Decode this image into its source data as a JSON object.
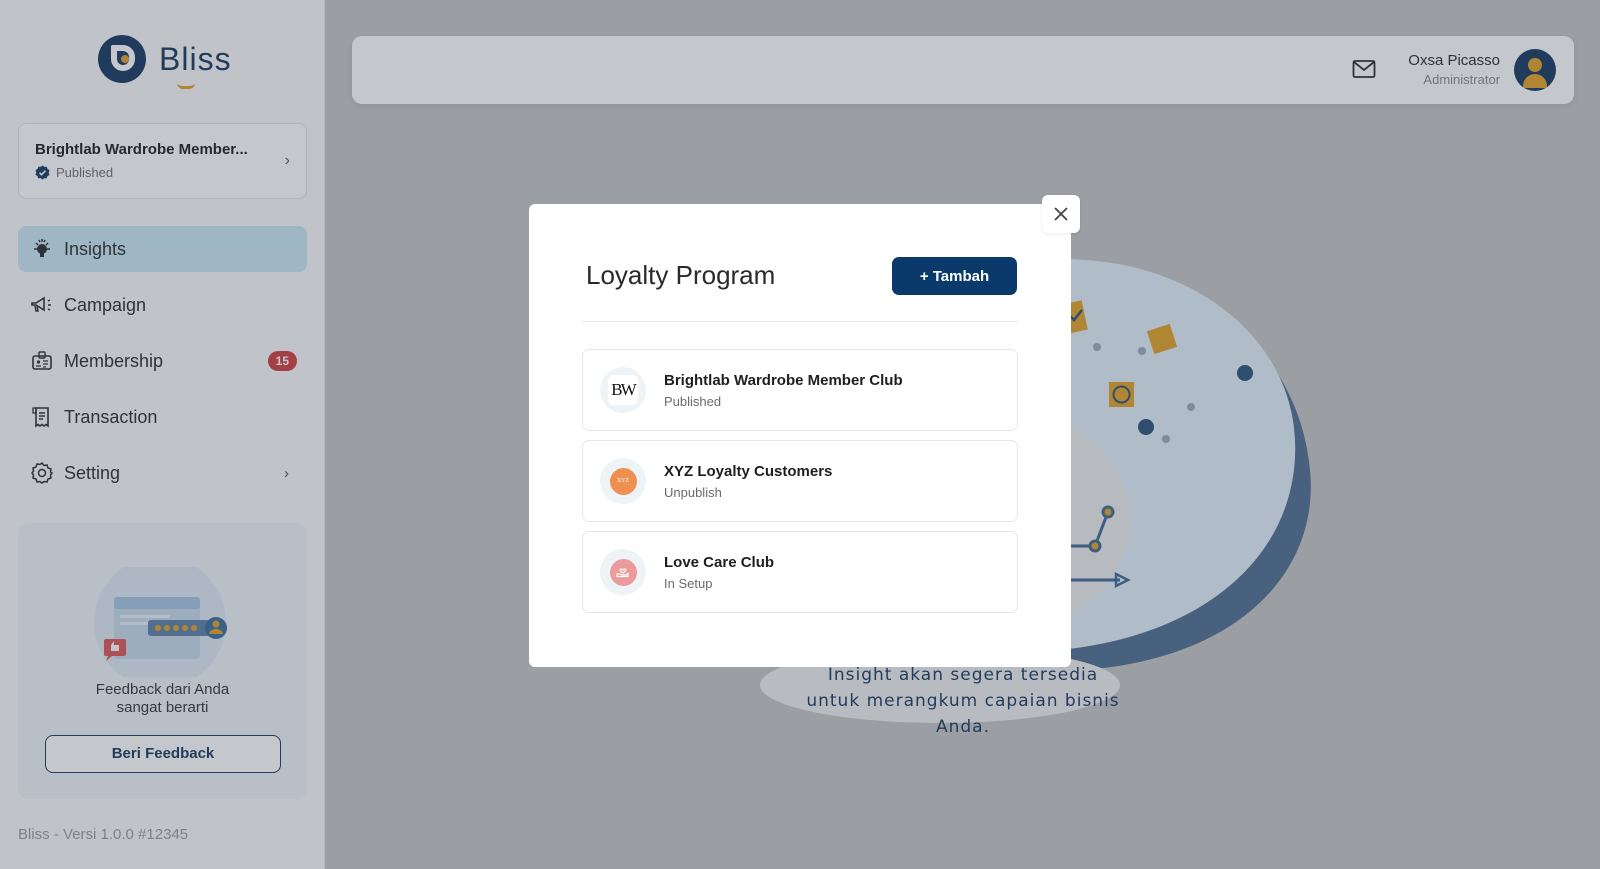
{
  "app": {
    "brand": "Bliss",
    "version_text": "Bliss - Versi 1.0.0 #12345"
  },
  "sidebar": {
    "current_program": {
      "name": "Brightlab Wardrobe Member...",
      "status": "Published",
      "status_icon": "verified-badge-icon"
    },
    "items": [
      {
        "label": "Insights",
        "icon": "lightbulb-icon",
        "active": true
      },
      {
        "label": "Campaign",
        "icon": "megaphone-icon"
      },
      {
        "label": "Membership",
        "icon": "id-card-icon",
        "badge": "15"
      },
      {
        "label": "Transaction",
        "icon": "receipt-icon"
      },
      {
        "label": "Setting",
        "icon": "gear-icon",
        "has_submenu": true
      }
    ],
    "feedback": {
      "message_line1": "Feedback dari Anda",
      "message_line2": "sangat berarti",
      "button_label": "Beri Feedback"
    }
  },
  "header": {
    "mail_icon": "mail-icon",
    "user": {
      "name": "Oxsa Picasso",
      "role": "Administrator"
    }
  },
  "main": {
    "empty_state": {
      "line1": "Insight akan segera tersedia",
      "line2": "untuk merangkum capaian bisnis Anda."
    }
  },
  "modal": {
    "title": "Loyalty Program",
    "add_button_label": "+ Tambah",
    "close_icon": "close-icon",
    "programs": [
      {
        "name": "Brightlab Wardrobe Member Club",
        "status": "Published",
        "logo_text": "BW"
      },
      {
        "name": "XYZ Loyalty Customers",
        "status": "Unpublish",
        "logo_text": "XYZ",
        "logo_color": "#ee9150"
      },
      {
        "name": "Love Care Club",
        "status": "In Setup",
        "logo_color": "#ec9a9a"
      }
    ]
  },
  "colors": {
    "brand_navy": "#16365f",
    "brand_gold": "#e2a025",
    "primary_button": "#0a3a6b",
    "badge_red": "#d23b3b",
    "active_nav": "#cbe7f3"
  }
}
